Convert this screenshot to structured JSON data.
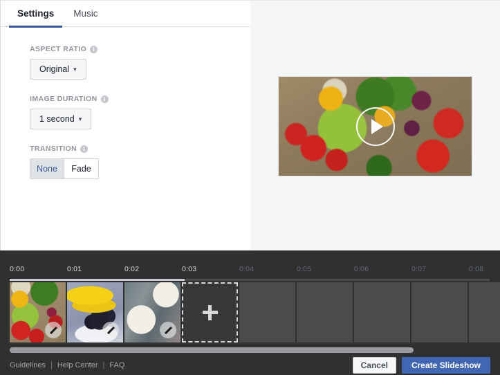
{
  "tabs": [
    {
      "label": "Settings",
      "active": true
    },
    {
      "label": "Music",
      "active": false
    }
  ],
  "settings": {
    "aspect_ratio": {
      "label": "ASPECT RATIO",
      "value": "Original",
      "info_glyph": "i"
    },
    "image_duration": {
      "label": "IMAGE DURATION",
      "value": "1 second",
      "info_glyph": "i"
    },
    "transition": {
      "label": "TRANSITION",
      "info_glyph": "i",
      "options": [
        {
          "label": "None",
          "selected": true
        },
        {
          "label": "Fade",
          "selected": false
        }
      ]
    }
  },
  "preview": {
    "play_label": "play-button",
    "alt": "Assorted fresh vegetables in a wooden bowl"
  },
  "timeline": {
    "ticks": [
      {
        "label": "0:00",
        "dim": false
      },
      {
        "label": "0:01",
        "dim": false
      },
      {
        "label": "0:02",
        "dim": false
      },
      {
        "label": "0:03",
        "dim": false
      },
      {
        "label": "0:04",
        "dim": true
      },
      {
        "label": "0:05",
        "dim": true
      },
      {
        "label": "0:06",
        "dim": true
      },
      {
        "label": "0:07",
        "dim": true
      },
      {
        "label": "0:08",
        "dim": true
      }
    ],
    "slots": [
      {
        "type": "image",
        "art": "thumb-veg",
        "edit": true
      },
      {
        "type": "image",
        "art": "thumb-banana",
        "edit": true
      },
      {
        "type": "image",
        "art": "thumb-grape",
        "edit": true
      },
      {
        "type": "add",
        "art": "",
        "edit": false
      },
      {
        "type": "empty",
        "art": "",
        "edit": false
      },
      {
        "type": "empty",
        "art": "",
        "edit": false
      },
      {
        "type": "empty",
        "art": "",
        "edit": false
      },
      {
        "type": "empty",
        "art": "",
        "edit": false
      },
      {
        "type": "empty",
        "art": "",
        "edit": false
      }
    ]
  },
  "footer": {
    "links": [
      "Guidelines",
      "Help Center",
      "FAQ"
    ],
    "separator": "|",
    "cancel_label": "Cancel",
    "create_label": "Create Slideshow"
  },
  "colors": {
    "accent_blue": "#4267b2",
    "tab_underline": "#365899",
    "timeline_bg": "#2f3031",
    "panel_bg": "#f5f6f7"
  }
}
